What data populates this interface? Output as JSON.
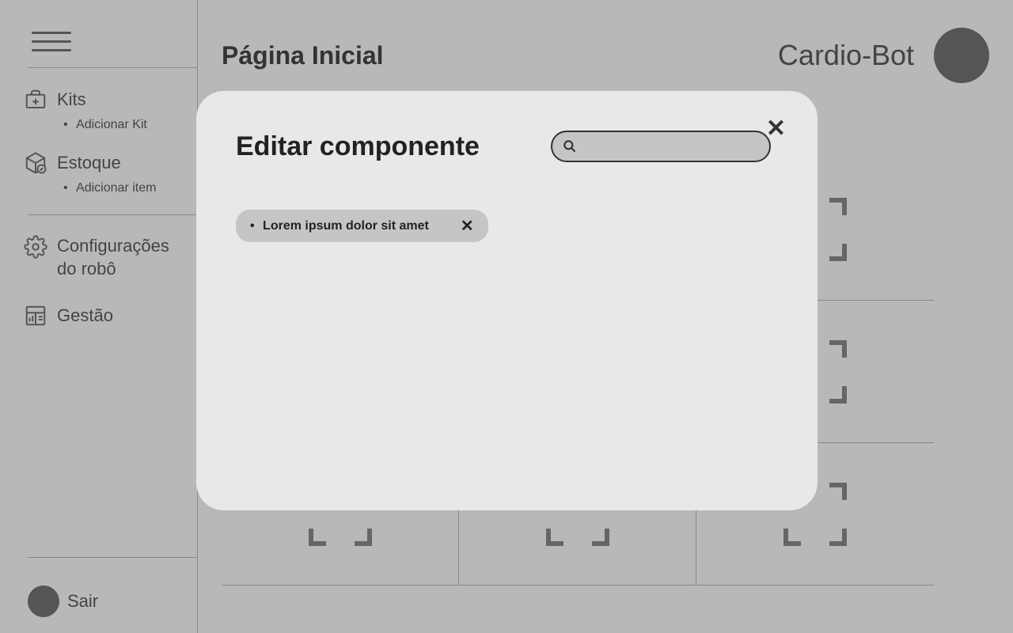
{
  "header": {
    "page_title": "Página Inicial",
    "brand": "Cardio-Bot"
  },
  "sidebar": {
    "kits": {
      "label": "Kits",
      "add": "Adicionar Kit"
    },
    "stock": {
      "label": "Estoque",
      "add": "Adicionar item"
    },
    "robot_config": {
      "label": "Configurações do robô"
    },
    "management": {
      "label": "Gestão"
    },
    "logout": "Sair"
  },
  "modal": {
    "title": "Editar componente",
    "search_placeholder": "",
    "chips": [
      {
        "label": "Lorem ipsum dolor sit amet"
      }
    ]
  }
}
